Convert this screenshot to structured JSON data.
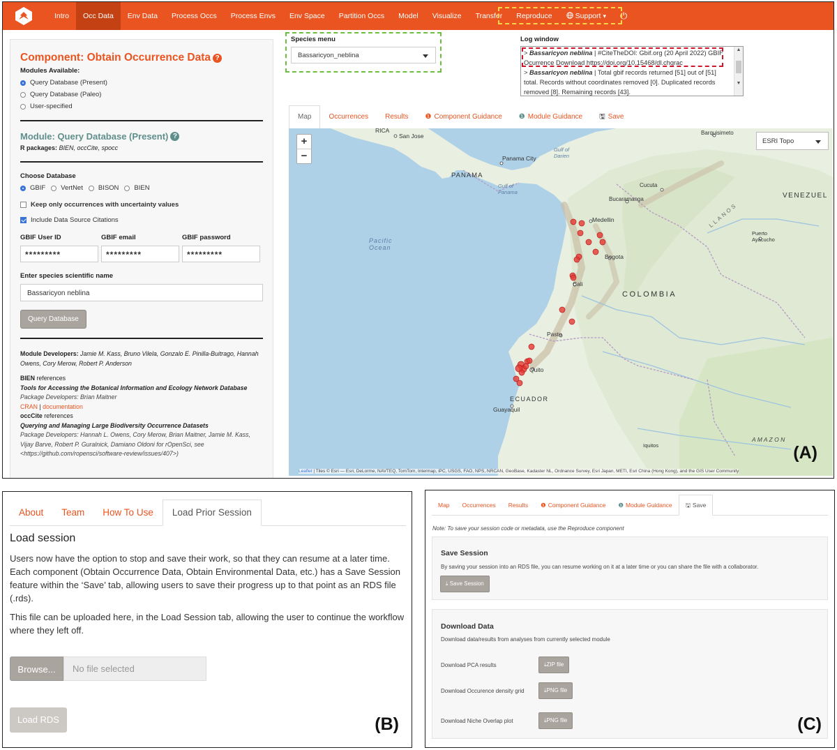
{
  "panel_a": {
    "nav": {
      "items": [
        "Intro",
        "Occ Data",
        "Env Data",
        "Process Occs",
        "Process Envs",
        "Env Space",
        "Partition Occs",
        "Model",
        "Visualize",
        "Transfer",
        "Reproduce",
        "Support"
      ],
      "active": "Occ Data",
      "support_caret": "▾",
      "power_icon": "⏻"
    },
    "component_title": "Component: Obtain Occurrence Data",
    "modules_available_label": "Modules Available:",
    "modules": [
      "Query Database (Present)",
      "Query Database (Paleo)",
      "User-specified"
    ],
    "module_title": "Module: Query Database (Present)",
    "r_packages_label": "R packages:",
    "r_packages": "BIEN, occCite, spocc",
    "choose_db_label": "Choose Database",
    "databases": [
      "GBIF",
      "VertNet",
      "BISON",
      "BIEN"
    ],
    "keep_uncertainty_label": "Keep only occurrences with uncertainty values",
    "include_citations_label": "Include Data Source Citations",
    "gbif_user_label": "GBIF User ID",
    "gbif_email_label": "GBIF email",
    "gbif_password_label": "GBIF password",
    "gbif_user_value": "*********",
    "gbif_email_value": "*********",
    "gbif_password_value": "*********",
    "species_name_label": "Enter species scientific name",
    "species_name_value": "Bassaricyon neblina",
    "query_button": "Query Database",
    "module_devs_label": "Module Developers:",
    "module_devs": "Jamie M. Kass, Bruno Vilela, Gonzalo E. Pinilla-Buitrago, Hannah Owens, Cory Merow, Robert P. Anderson",
    "bien_ref_name": "BIEN",
    "references_word": "references",
    "bien_ref_title": "Tools for Accessing the Botanical Information and Ecology Network Database",
    "bien_pkg_devs": "Package Developers: Brian Maitner",
    "cran_link": "CRAN",
    "doc_link": "documentation",
    "sep": "|",
    "occcite_ref_name": "occCite",
    "occcite_ref_title": "Querying and Managing Large Biodiversity Occurrence Datasets",
    "occcite_pkg_devs": "Package Developers: Hannah L. Owens, Cory Merow, Brian Maitner, Jamie M. Kass, Vijay Barve, Robert P. Guralnick, Damiano Oldoni for rOpenSci, see <https://github.com/ropensci/software-review/issues/407>)",
    "species_menu_label": "Species menu",
    "species_menu_value": "Bassaricyon_neblina",
    "log_title": "Log window",
    "log_line1_species": "Bassaricyon neblina",
    "log_line1_rest": " | #CiteTheDOI: Gbif.org (20 April 2022) GBIF Ocurrence Download https://doi.org/10.15468/dl.chgrac",
    "log_line2_species": "Bassaricyon neblina",
    "log_line2_rest": " | Total gbif records returned [51] out of [51] total. Records without coordinates removed [0]. Duplicated records removed [8]. Remaining records [43].",
    "tabs": [
      "Map",
      "Occurrences",
      "Results",
      "Component Guidance",
      "Module Guidance",
      "Save"
    ],
    "basemap": "ESRI Topo",
    "zoom_in": "+",
    "zoom_out": "−",
    "attribution_leaflet": "Leaflet",
    "attribution_rest": " | Tiles © Esri — Esri, DeLorme, NAVTEQ, TomTom, Intermap, iPC, USGS, FAO, NPS, NRCAN, GeoBase, Kadaster NL, Ordnance Survey, Esri Japan, METI, Esri China (Hong Kong), and the GIS User Community",
    "map_labels": [
      "RICA",
      "San Jose",
      "PANAMA",
      "Panama City",
      "Gulf of Darien",
      "Gulf of Panama",
      "Pacific Ocean",
      "Barquisimeto",
      "Cucuta",
      "Bucaramanga",
      "VENEZUEL",
      "Medellin",
      "Bogota",
      "COLOMBIA",
      "Cali",
      "Puerto Ayacucho",
      "Pasto",
      "Quito",
      "ECUADOR",
      "Guayaquil",
      "Iquitos",
      "A M A Z O N",
      "LLANOS"
    ],
    "label": "(A)"
  },
  "panel_b": {
    "tabs": [
      "About",
      "Team",
      "How To Use",
      "Load Prior Session"
    ],
    "active_tab": "Load Prior Session",
    "heading": "Load session",
    "para1": "Users now have the option to stop and save their work, so that they can resume at a later time. Each component (Obtain Occurrence Data, Obtain Environmental Data, etc.) has a Save Session feature within the ‘Save’ tab, allowing users to save their progress up to that point as an RDS file (.rds).",
    "para2": "This file can be uploaded here, in the Load Session tab, allowing the user to continue the workflow where they left off.",
    "browse": "Browse...",
    "file_placeholder": "No file selected",
    "load_button": "Load RDS",
    "label": "(B)"
  },
  "panel_c": {
    "tabs": [
      "Map",
      "Occurrences",
      "Results",
      "Component Guidance",
      "Module Guidance",
      "Save"
    ],
    "active_tab": "Save",
    "note": "Note: To save your session code or metadata, use the Reproduce component",
    "save_title": "Save Session",
    "save_text": "By saving your session into an RDS file, you can resume working on it at a later time or you can share the file with a collaborator.",
    "save_button": "Save Session",
    "download_title": "Download Data",
    "download_text": "Download data/results from analyses from currently selected module",
    "download_rows": [
      {
        "label": "Download PCA results",
        "button": "ZIP file"
      },
      {
        "label": "Download Occurence density grid",
        "button": "PNG file"
      },
      {
        "label": "Download Niche Overlap plot",
        "button": "PNG file"
      }
    ],
    "label": "(C)"
  },
  "colors": {
    "brand": "#e95420",
    "teal": "#5f8f8c",
    "species_dash": "#6cbf3c",
    "log_dash": "#d0162a",
    "nav_dash": "#f5d44a",
    "occurrence_point": "#e53935"
  }
}
